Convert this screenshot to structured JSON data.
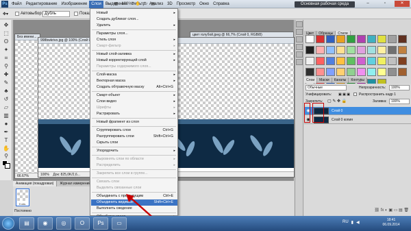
{
  "window": {
    "app_badge": "Ps",
    "menus": [
      "Файл",
      "Редактирование",
      "Изображение",
      "Слои",
      "Выделение",
      "Фильтр",
      "Анализ",
      "3D",
      "Просмотр",
      "Окно",
      "Справка"
    ],
    "active_menu": "Слои",
    "zoom": "100%",
    "workspace": "Основная рабочая среда"
  },
  "options": {
    "autoselect_label": "Автовыбор:",
    "autoselect_value": "Дубль",
    "show_controls": "Показ"
  },
  "documents": [
    {
      "title": "Без имени...",
      "zoom": "66.67%"
    },
    {
      "title": "998bwkrivo.jpg @ 100% (Слой 0 копия, RGB/8#)",
      "zoom": "100%",
      "status": "Док: 825,0K/2,6..."
    },
    {
      "title": "цвет голубой.jpeg @ 66,7% (Слой 0, RGB/8)"
    }
  ],
  "menu_items": [
    {
      "label": "Новый",
      "arrow": true
    },
    {
      "label": "Создать дубликат слоя..."
    },
    {
      "label": "Удалить",
      "arrow": true
    },
    {
      "sep": true
    },
    {
      "label": "Параметры слоя..."
    },
    {
      "label": "Стиль слоя",
      "arrow": true
    },
    {
      "label": "Смарт-фильтр",
      "disabled": true,
      "arrow": true
    },
    {
      "sep": true
    },
    {
      "label": "Новый слой-заливка",
      "arrow": true
    },
    {
      "label": "Новый корректирующий слой",
      "arrow": true
    },
    {
      "label": "Параметры содержимого слоя...",
      "disabled": true
    },
    {
      "sep": true
    },
    {
      "label": "Слой-маска",
      "arrow": true
    },
    {
      "label": "Векторная маска",
      "arrow": true
    },
    {
      "label": "Создать обтравочную маску",
      "shortcut": "Alt+Ctrl+G"
    },
    {
      "sep": true
    },
    {
      "label": "Смарт-объект",
      "arrow": true
    },
    {
      "label": "Слои видео",
      "arrow": true
    },
    {
      "label": "Шрифты",
      "disabled": true,
      "arrow": true
    },
    {
      "label": "Растрировать",
      "arrow": true
    },
    {
      "sep": true
    },
    {
      "label": "Новый фрагмент из слоя"
    },
    {
      "sep": true
    },
    {
      "label": "Сгруппировать слои",
      "shortcut": "Ctrl+G"
    },
    {
      "label": "Разгруппировать слои",
      "shortcut": "Shift+Ctrl+G"
    },
    {
      "label": "Скрыть слои"
    },
    {
      "sep": true
    },
    {
      "label": "Упорядочить",
      "arrow": true
    },
    {
      "sep": true
    },
    {
      "label": "Выровнять слои по области",
      "disabled": true,
      "arrow": true
    },
    {
      "label": "Распределить",
      "disabled": true,
      "arrow": true
    },
    {
      "sep": true
    },
    {
      "label": "Закрепить все слои в группе...",
      "disabled": true
    },
    {
      "sep": true
    },
    {
      "label": "Связать слои",
      "disabled": true
    },
    {
      "label": "Выделить связанные слои",
      "disabled": true
    },
    {
      "sep": true
    },
    {
      "label": "Объединить с предыдущим",
      "shortcut": "Ctrl+E"
    },
    {
      "label": "Объединить видимые",
      "shortcut": "Shift+Ctrl+E",
      "highlighted": true
    },
    {
      "label": "Выполнить сведение"
    },
    {
      "sep": true
    },
    {
      "label": "Обработка краев",
      "arrow": true
    }
  ],
  "right_panel": {
    "top_tabs": [
      "Цвет",
      "Образцы",
      "Стили"
    ],
    "active_top_tab": "Стили",
    "layer_tabs": [
      "Слои",
      "Маски",
      "Каналы",
      "Контуры"
    ],
    "active_layer_tab": "Слои",
    "blend_mode": "Обычные",
    "opacity_label": "Непрозрачность:",
    "opacity_value": "100%",
    "unify_label": "Унифицировать:",
    "propagate_label": "Распространить кадр 1",
    "lock_label": "Закрепить:",
    "fill_label": "Заливка:",
    "fill_value": "100%",
    "layers": [
      {
        "name": "Слой 0",
        "selected": true
      },
      {
        "name": "Слой 0 копия",
        "selected": false
      }
    ]
  },
  "animation_panel": {
    "tabs": [
      "Анимация (покадровая)",
      "Журнал измерений"
    ],
    "frame_number": "1",
    "frame_delay": "0 сек.",
    "loop": "Постоянно"
  },
  "taskbar": {
    "time": "18:41",
    "date": "06.09.2014",
    "language": "RU"
  },
  "colors": {
    "menu_highlight": "#3a73c4",
    "annotation_red": "#c80000",
    "banner_navy": "#0e2a44",
    "leaf_blue": "#8fb8d8"
  }
}
